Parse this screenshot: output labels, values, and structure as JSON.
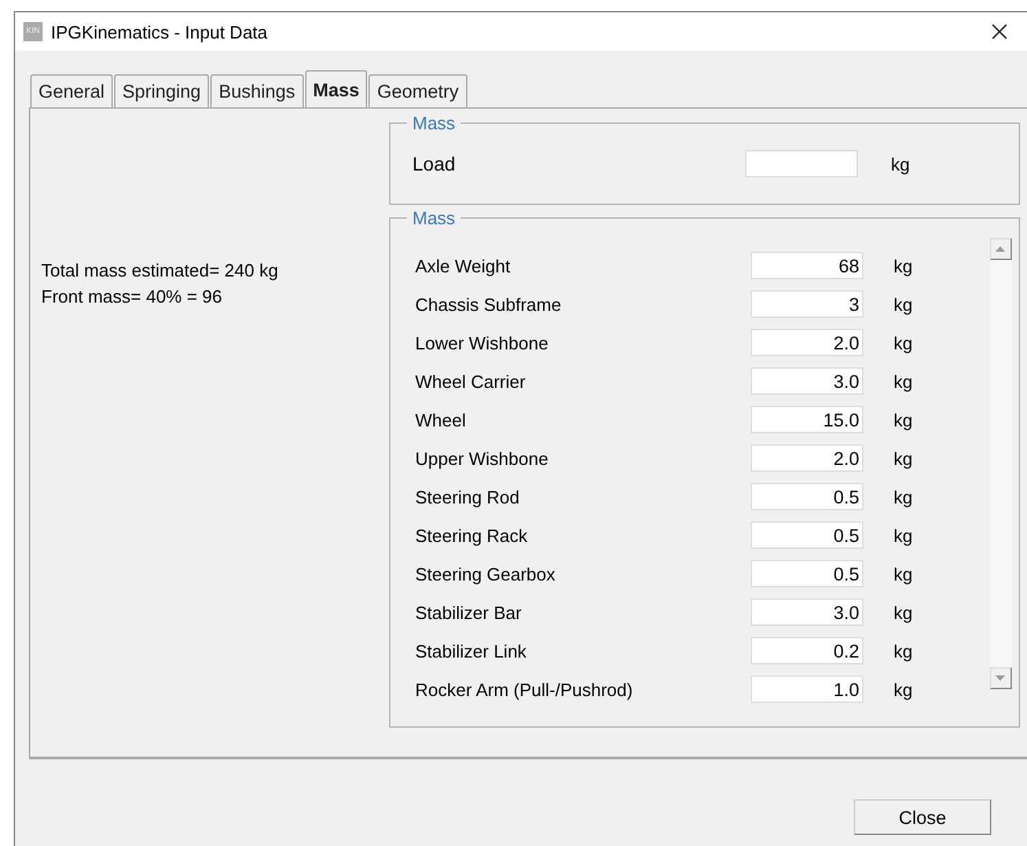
{
  "window": {
    "title": "IPGKinematics - Input Data",
    "app_icon_text": "KIN"
  },
  "tabs": [
    {
      "label": "General",
      "selected": false
    },
    {
      "label": "Springing",
      "selected": false
    },
    {
      "label": "Bushings",
      "selected": false
    },
    {
      "label": "Mass",
      "selected": true
    },
    {
      "label": "Geometry",
      "selected": false
    }
  ],
  "info_lines": [
    "Total mass estimated= 240 kg",
    "Front mass= 40% = 96"
  ],
  "load_group": {
    "title": "Mass",
    "fields": [
      {
        "label": "Load",
        "unit": "kg"
      }
    ]
  },
  "mass_group": {
    "title": "Mass",
    "fields": [
      {
        "label": "Axle Weight",
        "value": "68",
        "unit": "kg"
      },
      {
        "label": "Chassis Subframe",
        "value": "3",
        "unit": "kg"
      },
      {
        "label": "Lower Wishbone",
        "value": "2.0",
        "unit": "kg"
      },
      {
        "label": "Wheel Carrier",
        "value": "3.0",
        "unit": "kg"
      },
      {
        "label": "Wheel",
        "value": "15.0",
        "unit": "kg"
      },
      {
        "label": "Upper Wishbone",
        "value": "2.0",
        "unit": "kg"
      },
      {
        "label": "Steering Rod",
        "value": "0.5",
        "unit": "kg"
      },
      {
        "label": "Steering Rack",
        "value": "0.5",
        "unit": "kg"
      },
      {
        "label": "Steering Gearbox",
        "value": "0.5",
        "unit": "kg"
      },
      {
        "label": "Stabilizer Bar",
        "value": "3.0",
        "unit": "kg"
      },
      {
        "label": "Stabilizer Link",
        "value": "0.2",
        "unit": "kg"
      },
      {
        "label": "Rocker Arm (Pull-/Pushrod)",
        "value": "1.0",
        "unit": "kg"
      }
    ]
  },
  "buttons": [
    "Close"
  ]
}
